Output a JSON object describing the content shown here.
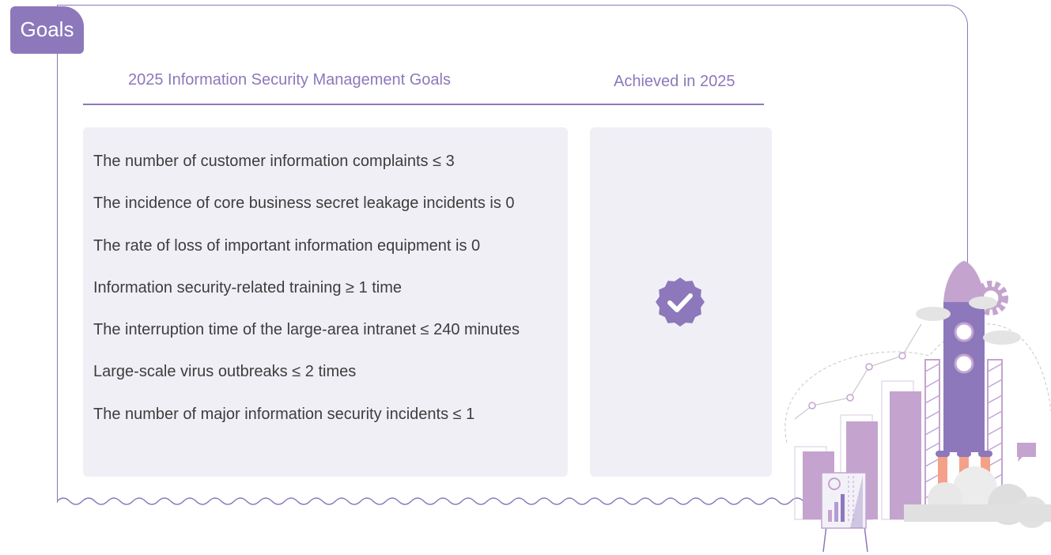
{
  "tab": {
    "label": "Goals"
  },
  "table": {
    "header_goals": "2025 Information Security Management Goals",
    "header_status": "Achieved in 2025",
    "goals": [
      "The number of customer information complaints ≤ 3",
      "The incidence of core business secret leakage incidents is 0",
      "The rate of loss of important information equipment is 0",
      "Information security-related training ≥ 1 time",
      "The interruption time of the large-area intranet ≤ 240 minutes",
      "Large-scale virus outbreaks ≤ 2 times",
      "The number of major information security incidents ≤ 1"
    ],
    "status_icon": "check-badge-icon"
  },
  "colors": {
    "accent": "#8c78bb",
    "panel_bg": "#f1eff6",
    "illustration_light": "#c4a4cf",
    "flame": "#f4a189"
  },
  "illustration": "rocket-launch-illustration"
}
